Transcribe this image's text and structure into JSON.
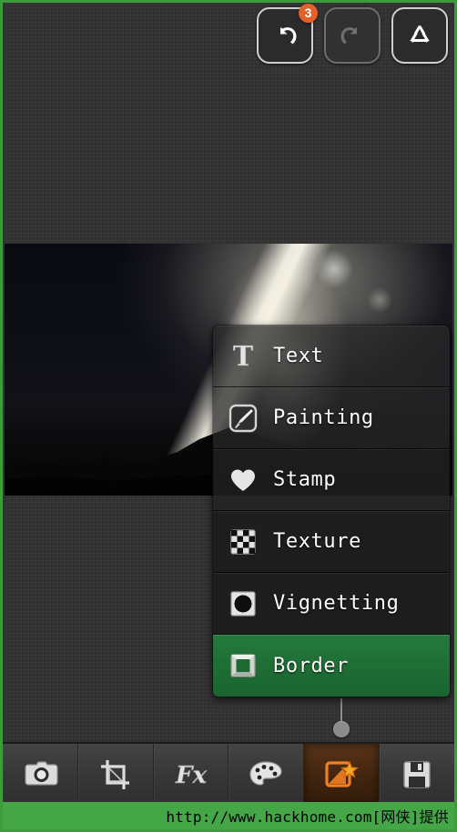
{
  "app": {
    "background_color": "#333333",
    "frame_color": "#3d9b3d",
    "accent_green": "#1d6b33",
    "accent_orange": "#e4622a"
  },
  "top_bar": {
    "buttons": [
      {
        "name": "undo",
        "icon": "undo-arrow-icon",
        "badge": "3",
        "enabled": "true"
      },
      {
        "name": "redo",
        "icon": "redo-arrow-icon",
        "badge": "",
        "enabled": "false"
      },
      {
        "name": "reset",
        "icon": "recycle-icon",
        "badge": "",
        "enabled": "true"
      }
    ]
  },
  "photo": {
    "alt": "night landscape with bright light flare and mountain silhouette"
  },
  "menu": {
    "items": [
      {
        "label": "Text",
        "icon": "text-t-icon",
        "selected": "false"
      },
      {
        "label": "Painting",
        "icon": "paintbrush-icon",
        "selected": "false"
      },
      {
        "label": "Stamp",
        "icon": "heart-icon",
        "selected": "false"
      },
      {
        "label": "Texture",
        "icon": "checkerboard-icon",
        "selected": "false"
      },
      {
        "label": "Vignetting",
        "icon": "vignette-circle-icon",
        "selected": "false"
      },
      {
        "label": "Border",
        "icon": "border-frame-icon",
        "selected": "true"
      }
    ]
  },
  "toolbar": {
    "items": [
      {
        "label": "Camera",
        "icon": "camera-icon",
        "active": "false"
      },
      {
        "label": "Crop",
        "icon": "crop-icon",
        "active": "false"
      },
      {
        "label": "Effects",
        "icon": "fx-icon",
        "active": "false"
      },
      {
        "label": "Palette",
        "icon": "palette-icon",
        "active": "false"
      },
      {
        "label": "Enhance",
        "icon": "magic-wand-icon",
        "active": "true"
      },
      {
        "label": "Save",
        "icon": "floppy-disk-icon",
        "active": "false"
      }
    ]
  },
  "watermark": {
    "text": "http://www.hackhome.com[网侠]提供",
    "background_color": "#45a648"
  }
}
